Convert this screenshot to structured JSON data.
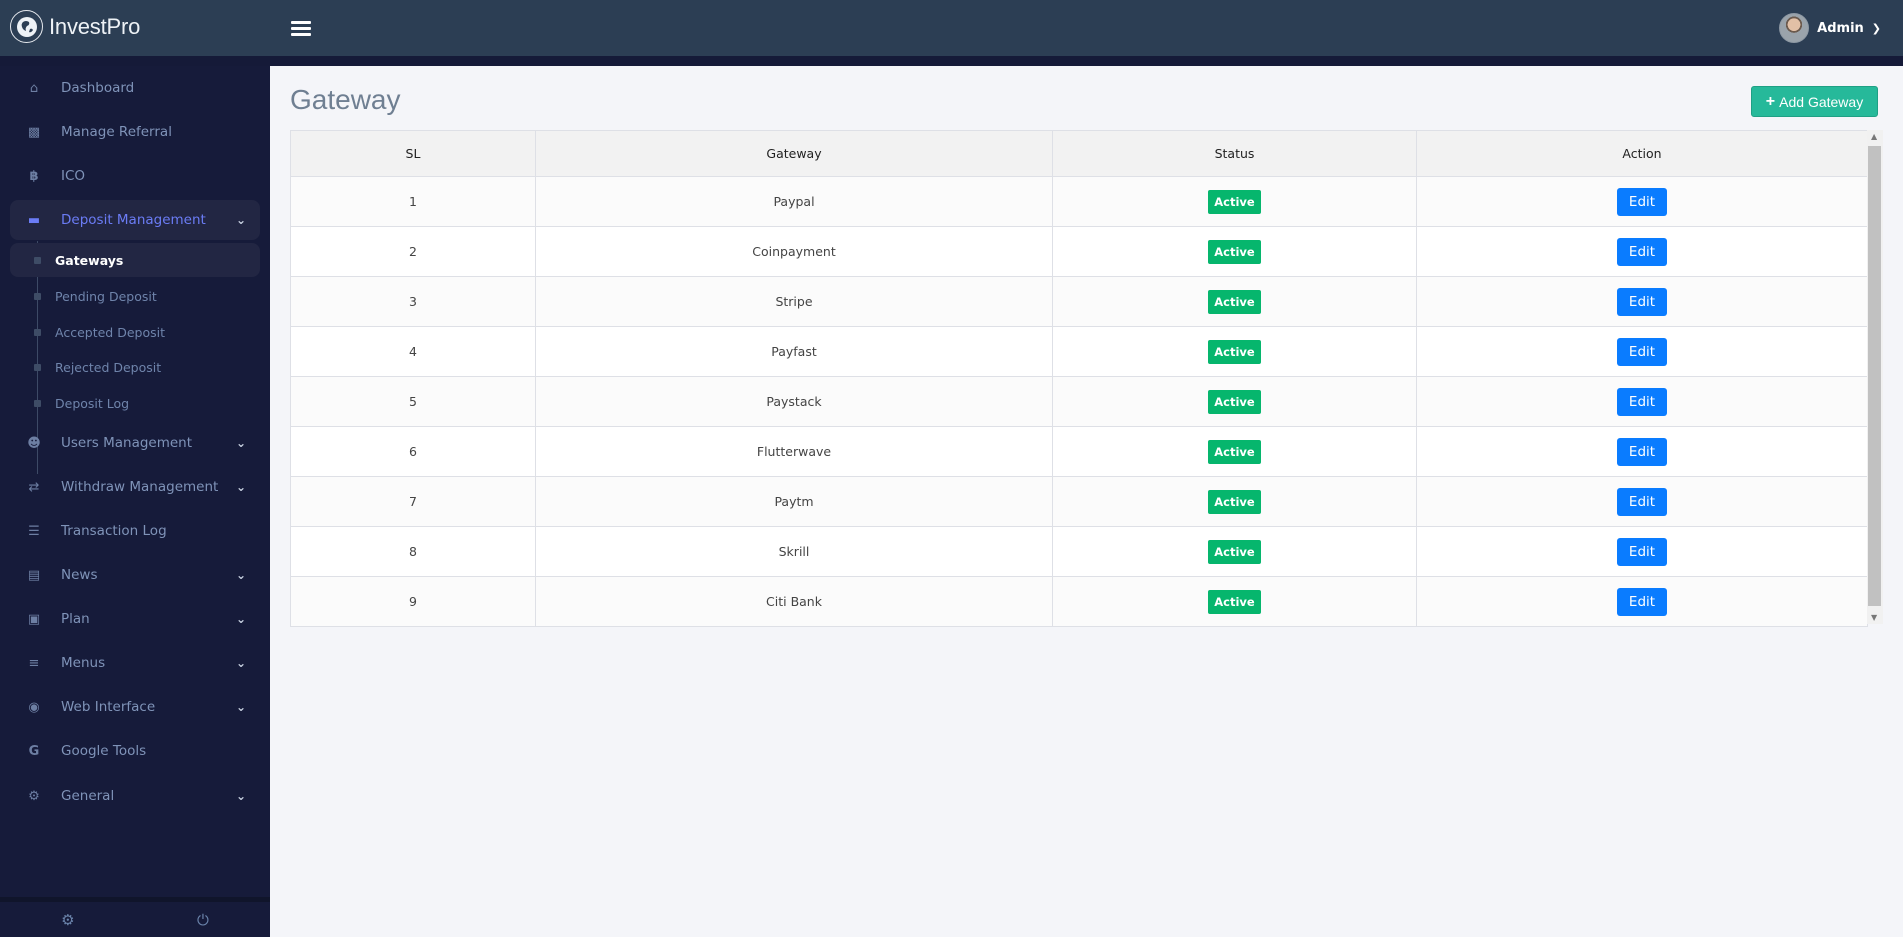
{
  "header": {
    "brand": "InvestPro",
    "brand_icon": "globe-icon",
    "menu_icon": "hamburger-icon",
    "user_name": "Admin",
    "user_chevron": "chevron-down-icon"
  },
  "sidebar": {
    "items": [
      {
        "label": "Dashboard",
        "icon": "home-icon"
      },
      {
        "label": "Manage Referral",
        "icon": "sitemap-icon"
      },
      {
        "label": "ICO",
        "icon": "bitcoin-icon"
      },
      {
        "label": "Deposit Management",
        "icon": "credit-card-icon",
        "expanded": true
      },
      {
        "label": "Users Management",
        "icon": "users-icon"
      },
      {
        "label": "Withdraw Management",
        "icon": "retweet-icon"
      },
      {
        "label": "Transaction Log",
        "icon": "list-icon"
      },
      {
        "label": "News",
        "icon": "newspaper-icon"
      },
      {
        "label": "Plan",
        "icon": "briefcase-icon"
      },
      {
        "label": "Menus",
        "icon": "bars-icon"
      },
      {
        "label": "Web Interface",
        "icon": "globe-icon"
      },
      {
        "label": "Google Tools",
        "icon": "google-icon"
      },
      {
        "label": "General",
        "icon": "cog-icon"
      }
    ],
    "deposit_sub": [
      {
        "label": "Gateways",
        "active": true
      },
      {
        "label": "Pending Deposit"
      },
      {
        "label": "Accepted Deposit"
      },
      {
        "label": "Rejected Deposit"
      },
      {
        "label": "Deposit Log"
      }
    ],
    "footer": {
      "settings_icon": "cog-icon",
      "logout_icon": "power-icon"
    }
  },
  "main": {
    "title": "Gateway",
    "add_button": "Add Gateway",
    "table": {
      "headers": [
        "SL",
        "Gateway",
        "Status",
        "Action"
      ],
      "rows": [
        {
          "sl": "1",
          "gateway": "Paypal",
          "status": "Active",
          "action": "Edit"
        },
        {
          "sl": "2",
          "gateway": "Coinpayment",
          "status": "Active",
          "action": "Edit"
        },
        {
          "sl": "3",
          "gateway": "Stripe",
          "status": "Active",
          "action": "Edit"
        },
        {
          "sl": "4",
          "gateway": "Payfast",
          "status": "Active",
          "action": "Edit"
        },
        {
          "sl": "5",
          "gateway": "Paystack",
          "status": "Active",
          "action": "Edit"
        },
        {
          "sl": "6",
          "gateway": "Flutterwave",
          "status": "Active",
          "action": "Edit"
        },
        {
          "sl": "7",
          "gateway": "Paytm",
          "status": "Active",
          "action": "Edit"
        },
        {
          "sl": "8",
          "gateway": "Skrill",
          "status": "Active",
          "action": "Edit"
        },
        {
          "sl": "9",
          "gateway": "Citi Bank",
          "status": "Active",
          "action": "Edit"
        }
      ]
    }
  },
  "colors": {
    "topbar": "#2c3e54",
    "sidebar": "#161b3a",
    "accent_active": "#6b7cf5",
    "add_button": "#26b99a",
    "status_active": "#06b66d",
    "edit_button": "#0a7cff"
  }
}
